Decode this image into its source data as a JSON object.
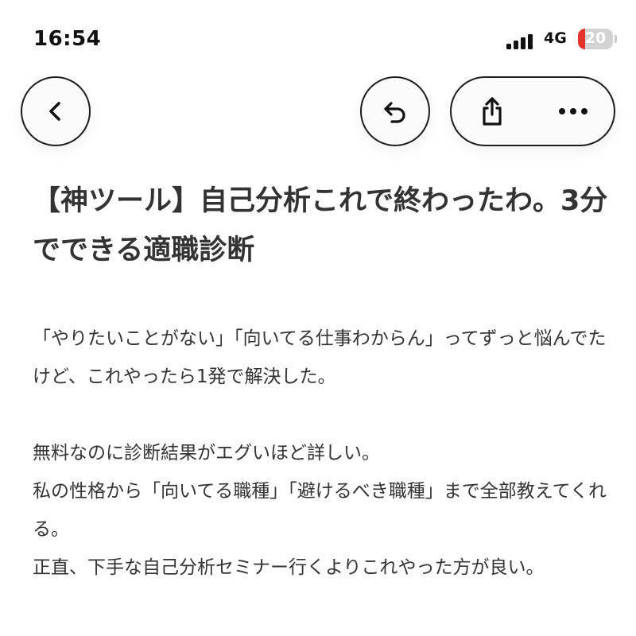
{
  "status_bar": {
    "time": "16:54",
    "network": "4G",
    "battery_level": "20",
    "battery_color": "#e5322b"
  },
  "nav": {
    "back_icon": "chevron-left-icon",
    "undo_icon": "undo-icon",
    "share_icon": "share-icon",
    "more_icon": "more-icon"
  },
  "article": {
    "title": "【神ツール】自己分析これで終わったわ。3分でできる適職診断",
    "paragraphs": [
      "「やりたいことがない」「向いてる仕事わからん」ってずっと悩んでたけど、これやったら1発で解決した。",
      "無料なのに診断結果がエグいほど詳しい。\n私の性格から「向いてる職種」「避けるべき職種」まで全部教えてくれる。\n正直、下手な自己分析セミナー行くよりこれやった方が良い。"
    ]
  },
  "colors": {
    "text": "#333333",
    "background": "#ffffff",
    "button_border": "#1c1c1c"
  }
}
